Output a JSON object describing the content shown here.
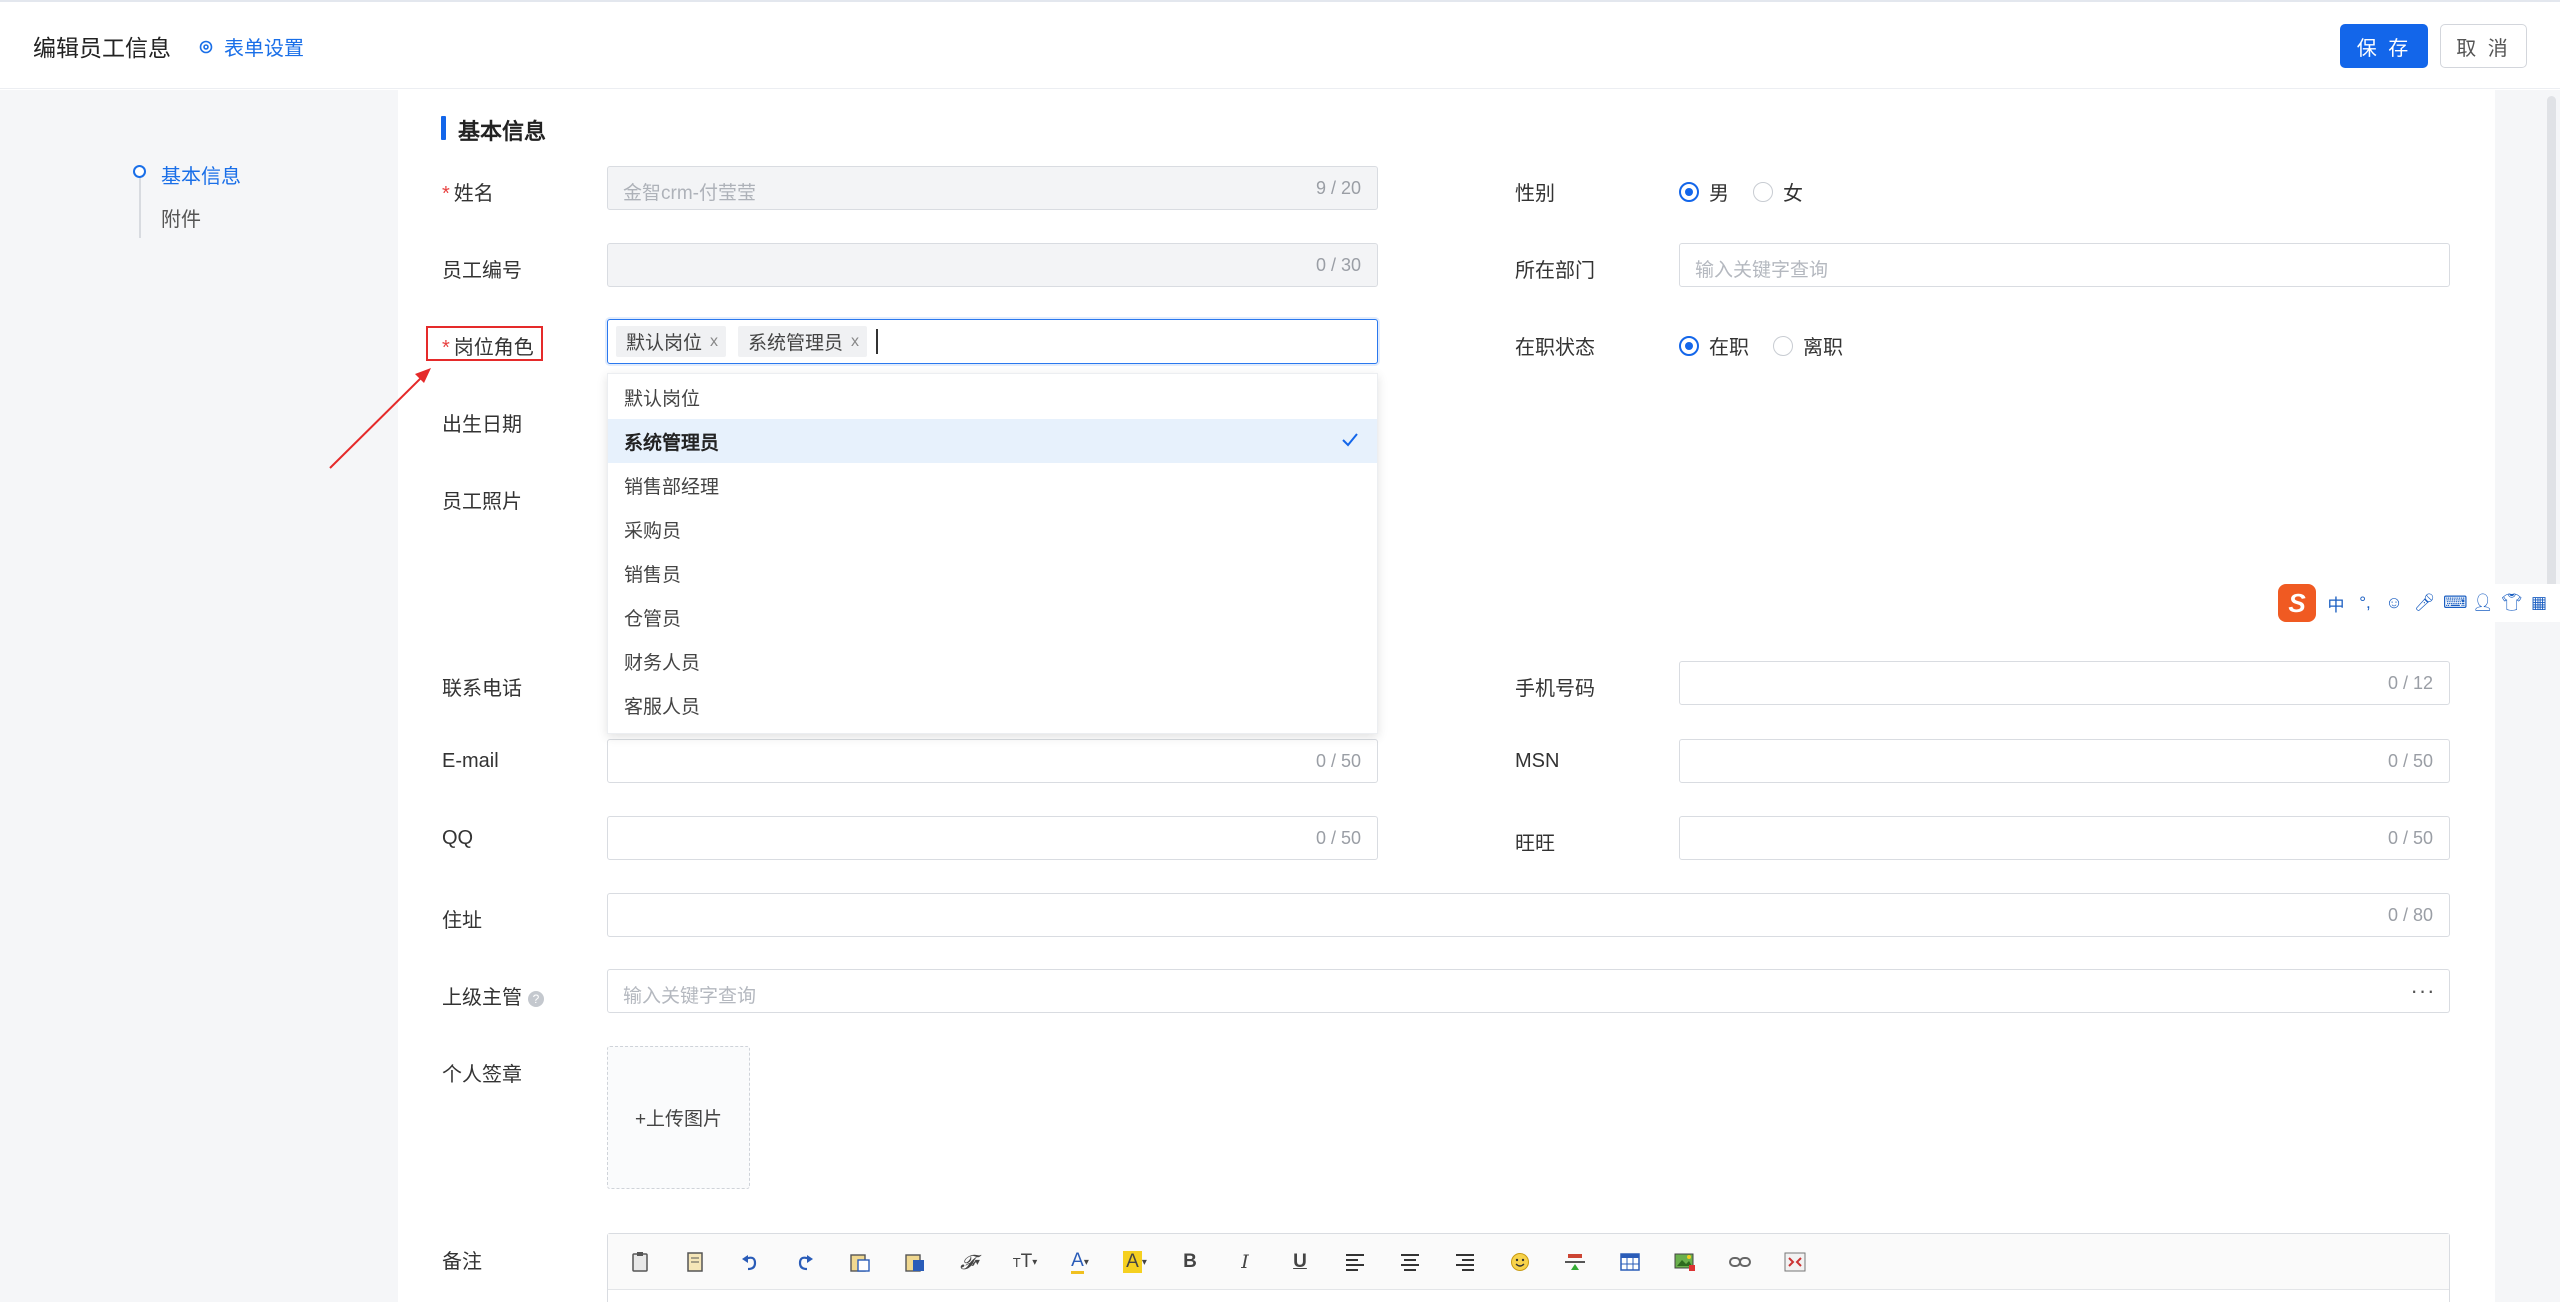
{
  "header": {
    "title": "编辑员工信息",
    "form_settings": "表单设置",
    "save": "保 存",
    "cancel": "取 消"
  },
  "sidebar": {
    "items": [
      {
        "label": "基本信息",
        "active": true
      },
      {
        "label": "附件",
        "active": false
      }
    ]
  },
  "section": {
    "title": "基本信息"
  },
  "fields": {
    "name": {
      "label": "姓名",
      "required_mark": "*",
      "value": "金智crm-付莹莹",
      "count": "9 / 20"
    },
    "employee_no": {
      "label": "员工编号",
      "value": "",
      "count": "0 / 30"
    },
    "role": {
      "label": "岗位角色",
      "required_mark": "*",
      "tags": [
        "默认岗位",
        "系统管理员"
      ],
      "tag_close": "x"
    },
    "birthday": {
      "label": "出生日期"
    },
    "photo": {
      "label": "员工照片"
    },
    "phone": {
      "label": "联系电话"
    },
    "email": {
      "label": "E-mail",
      "count": "0 / 50"
    },
    "qq": {
      "label": "QQ",
      "count": "0 / 50"
    },
    "address": {
      "label": "住址",
      "count": "0 / 80"
    },
    "supervisor": {
      "label": "上级主管",
      "help": "?",
      "placeholder": "输入关键字查询",
      "more": "···"
    },
    "signature": {
      "label": "个人签章",
      "upload": "+上传图片"
    },
    "remark": {
      "label": "备注"
    },
    "gender": {
      "label": "性别",
      "options": [
        "男",
        "女"
      ],
      "selected": "男"
    },
    "department": {
      "label": "所在部门",
      "placeholder": "输入关键字查询"
    },
    "status": {
      "label": "在职状态",
      "options": [
        "在职",
        "离职"
      ],
      "selected": "在职"
    },
    "mobile": {
      "label": "手机号码",
      "count": "0 / 12"
    },
    "msn": {
      "label": "MSN",
      "count": "0 / 50"
    },
    "wangwang": {
      "label": "旺旺",
      "count": "0 / 50"
    }
  },
  "dropdown": {
    "options": [
      "默认岗位",
      "系统管理员",
      "销售部经理",
      "采购员",
      "销售员",
      "仓管员",
      "财务人员",
      "客服人员"
    ],
    "selected": "系统管理员"
  },
  "ime": {
    "logo": "S",
    "lang": "中",
    "punct": "°,"
  },
  "colors": {
    "primary": "#1366ea",
    "required": "#e8403f",
    "annotation": "#e52a2a"
  }
}
